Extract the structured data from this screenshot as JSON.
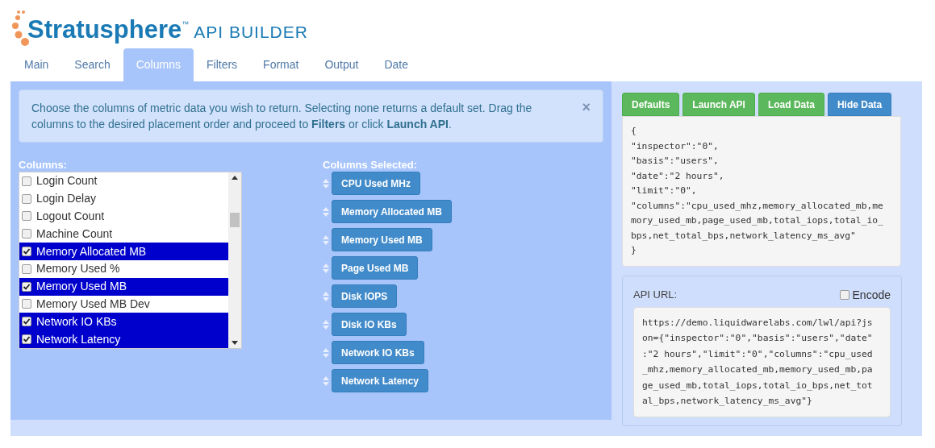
{
  "brand": {
    "name": "Stratusphere",
    "trademark": "™",
    "subtitle": "API BUILDER"
  },
  "tabs": [
    {
      "label": "Main",
      "selected": false
    },
    {
      "label": "Search",
      "selected": false
    },
    {
      "label": "Columns",
      "selected": true
    },
    {
      "label": "Filters",
      "selected": false
    },
    {
      "label": "Format",
      "selected": false
    },
    {
      "label": "Output",
      "selected": false
    },
    {
      "label": "Date",
      "selected": false
    }
  ],
  "alert": {
    "text": "Choose the columns of metric data you wish to return. Selecting none returns a default set. Drag the columns to the desired placement order and proceed to **Filters** or click **Launch API**.",
    "close": "×"
  },
  "columns_list": {
    "label": "Columns:",
    "items": [
      {
        "label": "Login Count",
        "checked": false
      },
      {
        "label": "Login Delay",
        "checked": false
      },
      {
        "label": "Logout Count",
        "checked": false
      },
      {
        "label": "Machine Count",
        "checked": false
      },
      {
        "label": "Memory Allocated MB",
        "checked": true
      },
      {
        "label": "Memory Used %",
        "checked": false
      },
      {
        "label": "Memory Used MB",
        "checked": true
      },
      {
        "label": "Memory Used MB Dev",
        "checked": false
      },
      {
        "label": "Network IO KBs",
        "checked": true
      },
      {
        "label": "Network Latency",
        "checked": true
      }
    ]
  },
  "selected_columns": {
    "label": "Columns Selected:",
    "items": [
      "CPU Used MHz",
      "Memory Allocated MB",
      "Memory Used MB",
      "Page Used MB",
      "Disk IOPS",
      "Disk IO KBs",
      "Network IO KBs",
      "Network Latency"
    ]
  },
  "buttons": [
    {
      "label": "Defaults",
      "kind": "success"
    },
    {
      "label": "Launch API",
      "kind": "success"
    },
    {
      "label": "Load Data",
      "kind": "success"
    },
    {
      "label": "Hide Data",
      "kind": "primary"
    }
  ],
  "json_preview": [
    "{",
    "\"inspector\":\"0\",",
    "\"basis\":\"users\",",
    "\"date\":\"2 hours\",",
    "\"limit\":\"0\",",
    "\"columns\":\"cpu_used_mhz,memory_allocated_mb,me",
    "mory_used_mb,page_used_mb,total_iops,total_io_",
    "bps,net_total_bps,network_latency_ms_avg\"",
    "}"
  ],
  "api_url": {
    "label": "API URL:",
    "encode": {
      "label": "Encode",
      "checked": false
    },
    "lines": [
      "https://demo.liquidwarelabs.com/lwl/api?js",
      "on={\"inspector\":\"0\",\"basis\":\"users\",\"date\"",
      ":\"2 hours\",\"limit\":\"0\",\"columns\":\"cpu_used",
      "_mhz,memory_allocated_mb,memory_used_mb,pa",
      "ge_used_mb,total_iops,total_io_bps,net_tot",
      "al_bps,network_latency_ms_avg\"}"
    ]
  }
}
